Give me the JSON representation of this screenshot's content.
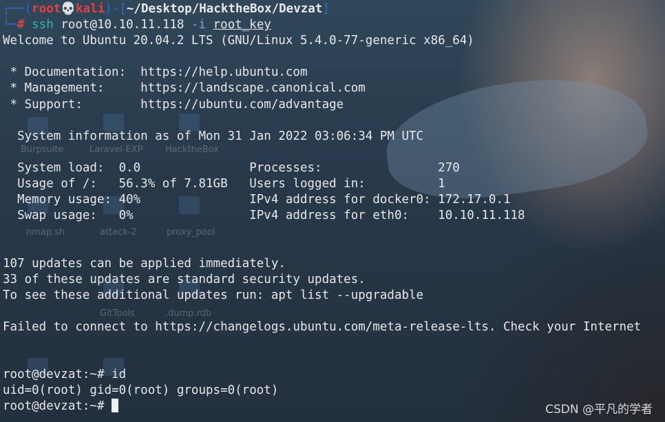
{
  "desktop": {
    "labels": [
      "Burpsuite",
      "Laravel-EXP",
      "HacktheBox",
      "nmap.sh",
      "attack-2",
      "proxy_pool",
      "GitTools",
      ".dump.rdb"
    ]
  },
  "prompt": {
    "open": "┌──(",
    "user": "root",
    "skull": "💀",
    "host": "kali",
    "mid": ")-[",
    "path": "~/Desktop/HacktheBox/Devzat",
    "close": "]",
    "corner": "└─",
    "hash": "#",
    "cmd": "ssh",
    "target": "root@10.10.11.118",
    "flag": "-i",
    "keyfile": "root_key"
  },
  "motd": {
    "welcome": "Welcome to Ubuntu 20.04.2 LTS (GNU/Linux 5.4.0-77-generic x86_64)",
    "doc": " * Documentation:  https://help.ubuntu.com",
    "mgmt": " * Management:     https://landscape.canonical.com",
    "support": " * Support:        https://ubuntu.com/advantage",
    "sysinfo": "  System information as of Mon 31 Jan 2022 03:06:34 PM UTC",
    "stat1": "  System load:  0.0               Processes:                270",
    "stat2": "  Usage of /:   56.3% of 7.81GB   Users logged in:          1",
    "stat3": "  Memory usage: 40%               IPv4 address for docker0: 172.17.0.1",
    "stat4": "  Swap usage:   0%                IPv4 address for eth0:    10.10.11.118",
    "upd1": "107 updates can be applied immediately.",
    "upd2": "33 of these updates are standard security updates.",
    "upd3": "To see these additional updates run: apt list --upgradable",
    "failed": "Failed to connect to https://changelogs.ubuntu.com/meta-release-lts. Check your Internet"
  },
  "session": {
    "cmd_line": "root@devzat:~# id",
    "output": "uid=0(root) gid=0(root) groups=0(root)",
    "prompt": "root@devzat:~# "
  },
  "watermark": "CSDN @平凡的学者"
}
